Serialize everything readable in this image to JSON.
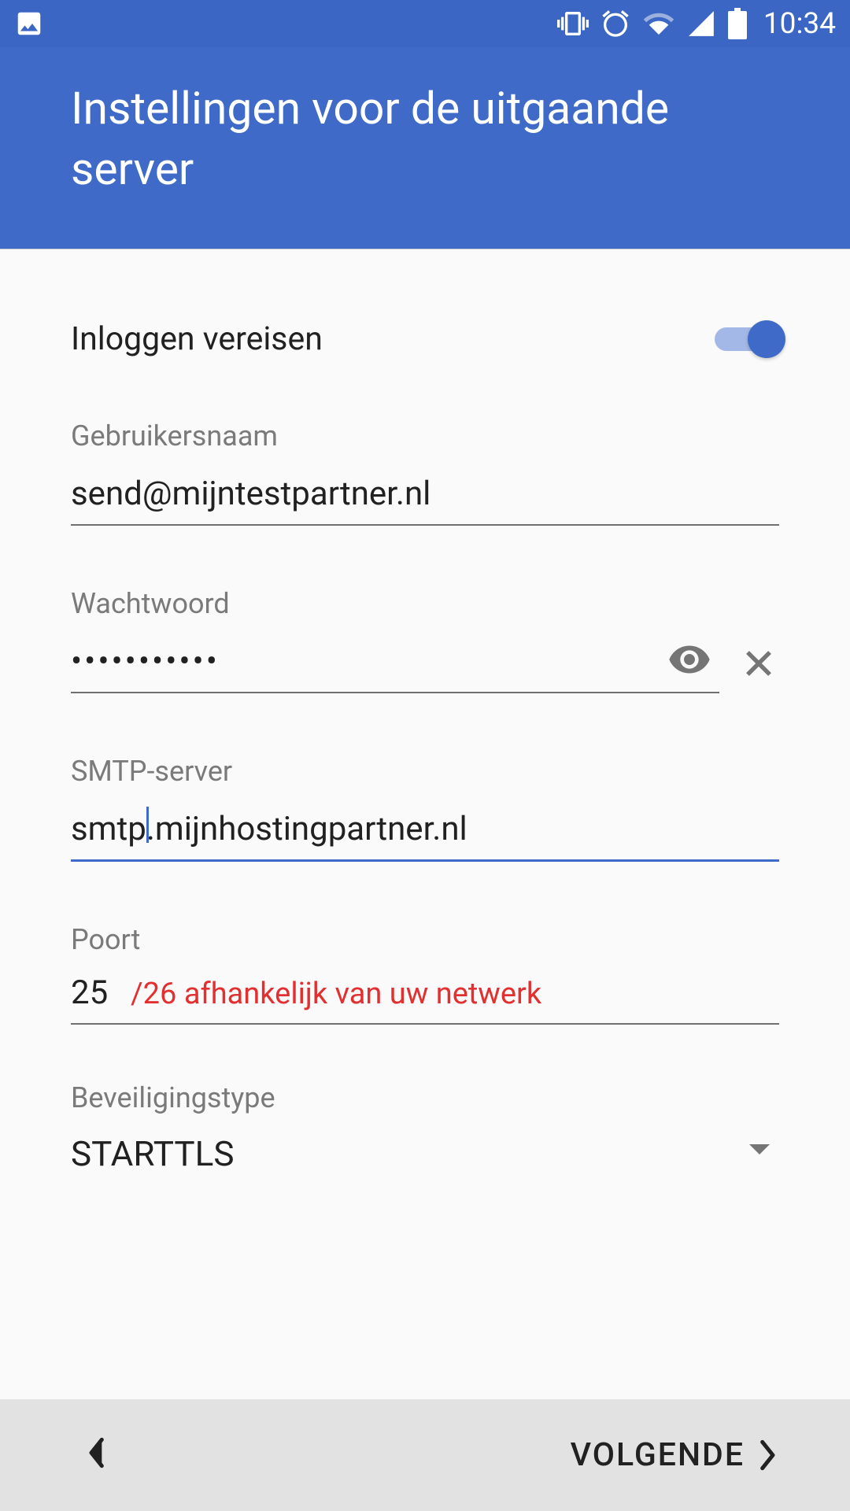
{
  "statusBar": {
    "time": "10:34"
  },
  "header": {
    "title": "Instellingen voor de uitgaande server"
  },
  "form": {
    "requireLogin": {
      "label": "Inloggen vereisen",
      "value": true
    },
    "username": {
      "label": "Gebruikersnaam",
      "value": "send@mijntestpartner.nl"
    },
    "password": {
      "label": "Wachtwoord",
      "value": "•••••••••••"
    },
    "smtpServer": {
      "label": "SMTP-server",
      "value": "smtp.mijnhostingpartner.nl"
    },
    "port": {
      "label": "Poort",
      "value": "25",
      "note": "/26 afhankelijk van uw netwerk"
    },
    "securityType": {
      "label": "Beveiligingstype",
      "value": "STARTTLS"
    }
  },
  "bottomBar": {
    "next": "VOLGENDE"
  }
}
